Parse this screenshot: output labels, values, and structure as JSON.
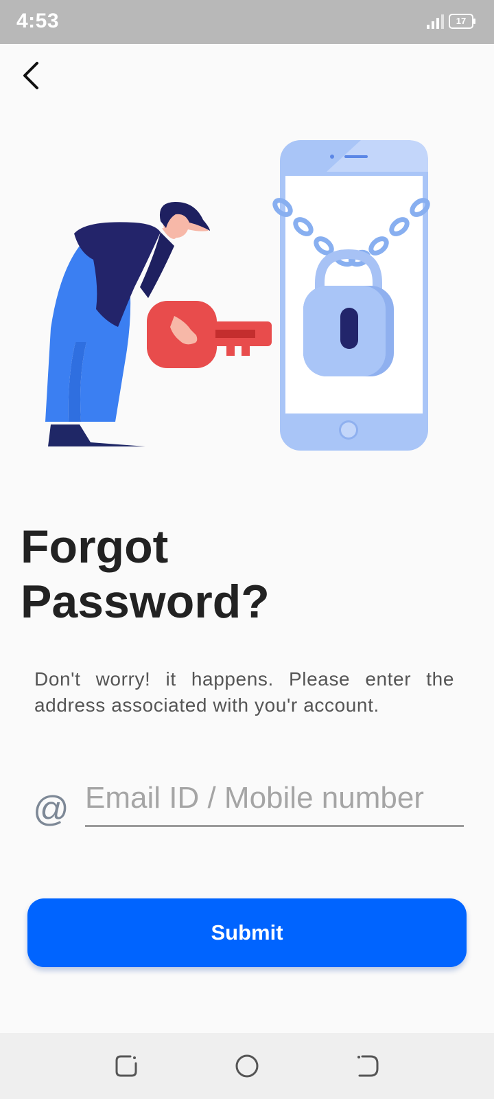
{
  "status_bar": {
    "time": "4:53",
    "battery_level": "17",
    "icons": [
      "signal-icon",
      "battery-icon"
    ]
  },
  "header": {
    "back_icon": "chevron-left-icon"
  },
  "illustration": {
    "name": "forgot-password-illustration"
  },
  "main": {
    "title_line1": "Forgot",
    "title_line2": "Password?",
    "description": "Don't worry! it happens. Please enter the address associated with you'r account.",
    "email_icon": "@",
    "email_placeholder": "Email ID / Mobile number",
    "email_value": "",
    "submit_label": "Submit"
  },
  "nav_bar": {
    "icons": [
      "recent-apps-icon",
      "home-icon",
      "back-nav-icon"
    ]
  },
  "colors": {
    "accent": "#0064ff",
    "status_bar": "#b8b8b8",
    "key_red": "#e84c4c",
    "phone_blue": "#a9c5f7"
  }
}
